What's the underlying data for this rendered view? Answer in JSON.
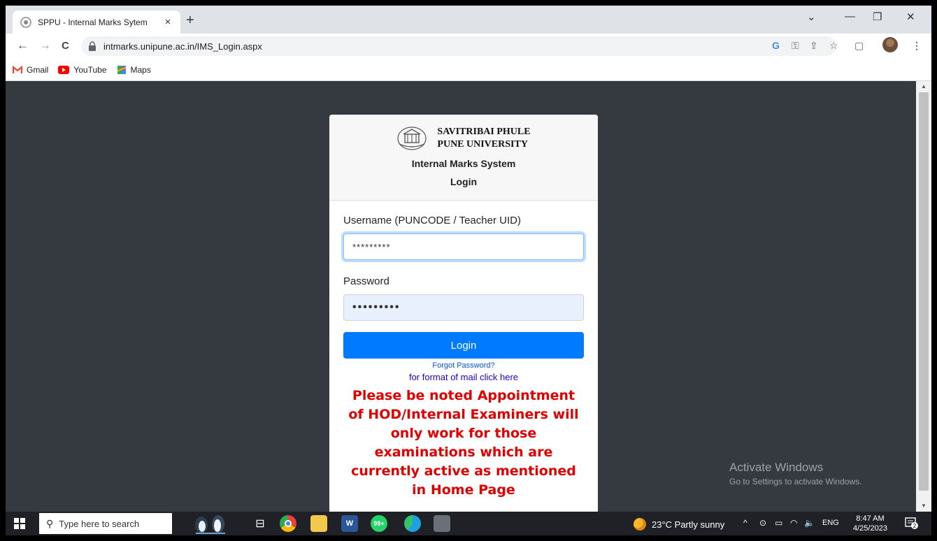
{
  "browser": {
    "tab_title": "SPPU - Internal Marks Sytem",
    "tab_close": "×",
    "new_tab": "+",
    "url": "intmarks.unipune.ac.in/IMS_Login.aspx",
    "back": "←",
    "forward": "→",
    "reload": "C",
    "win_minimize": "—",
    "win_restore": "❐",
    "win_close": "✕",
    "tab_search": "⌄",
    "toolbar_icons": {
      "google": "G",
      "key": "⚿",
      "share": "⇪",
      "star": "☆",
      "sidepanel": "▢",
      "menu": "⋮"
    }
  },
  "bookmarks": [
    {
      "label": "Gmail",
      "icon": "gmail-icon"
    },
    {
      "label": "YouTube",
      "icon": "youtube-icon"
    },
    {
      "label": "Maps",
      "icon": "maps-icon"
    }
  ],
  "login_card": {
    "university_line1": "SAVITRIBAI PHULE",
    "university_line2": "PUNE UNIVERSITY",
    "system_title": "Internal Marks System",
    "login_heading": "Login",
    "username_label": "Username (PUNCODE / Teacher UID)",
    "username_value": "*********",
    "password_label": "Password",
    "password_value": "•••••••••",
    "login_button": "Login",
    "forgot_password": "Forgot Password?",
    "format_link": "for format of mail click here",
    "notice": "Please be noted Appointment of HOD/Internal Examiners will only work for those examinations which are currently active as mentioned in Home Page"
  },
  "watermark": {
    "line1": "Activate Windows",
    "line2": "Go to Settings to activate Windows."
  },
  "taskbar": {
    "search_placeholder": "Type here to search",
    "whatsapp_badge": "99+",
    "weather": "23°C  Partly sunny",
    "tray_chevron": "^",
    "language": "ENG",
    "time": "8:47 AM",
    "date": "4/25/2023",
    "notification_count": "2"
  },
  "colors": {
    "page_background": "#343a40",
    "login_button": "#007bff",
    "notice_text": "#e00000",
    "link": "#0056d6"
  }
}
